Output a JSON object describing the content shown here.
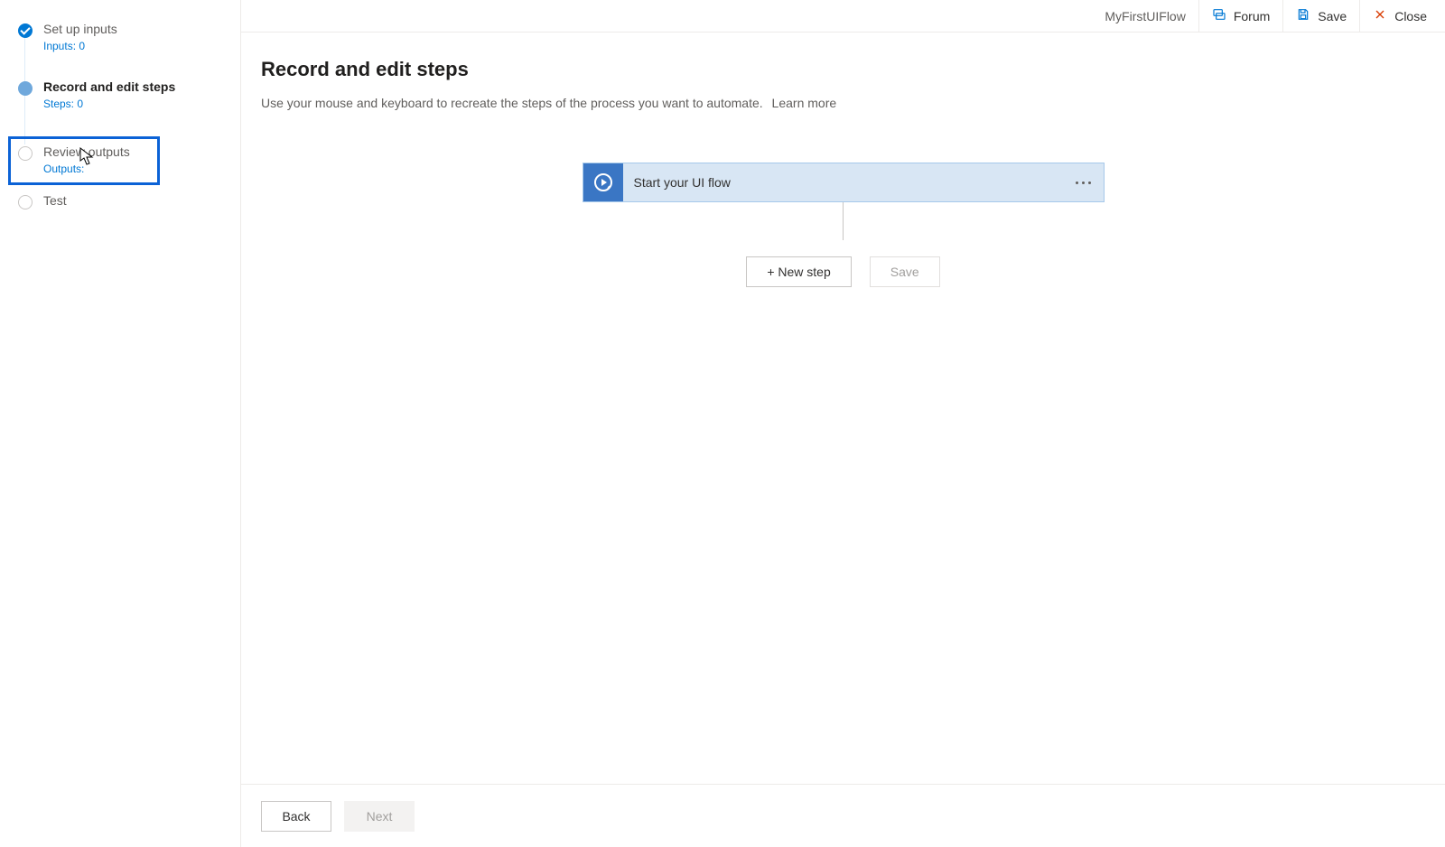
{
  "header": {
    "flow_name": "MyFirstUIFlow",
    "forum_label": "Forum",
    "save_label": "Save",
    "close_label": "Close"
  },
  "sidebar": {
    "steps": [
      {
        "title": "Set up inputs",
        "sub": "Inputs: 0",
        "state": "completed"
      },
      {
        "title": "Record and edit steps",
        "sub": "Steps: 0",
        "state": "current"
      },
      {
        "title": "Review outputs",
        "sub": "Outputs:",
        "state": "pending",
        "highlighted": true
      },
      {
        "title": "Test",
        "sub": "",
        "state": "pending"
      }
    ]
  },
  "main": {
    "title": "Record and edit steps",
    "description": "Use your mouse and keyboard to recreate the steps of the process you want to automate.",
    "learn_more": "Learn more",
    "action_card_label": "Start your UI flow",
    "new_step_label": "+ New step",
    "save_label": "Save"
  },
  "footer": {
    "back_label": "Back",
    "next_label": "Next"
  }
}
